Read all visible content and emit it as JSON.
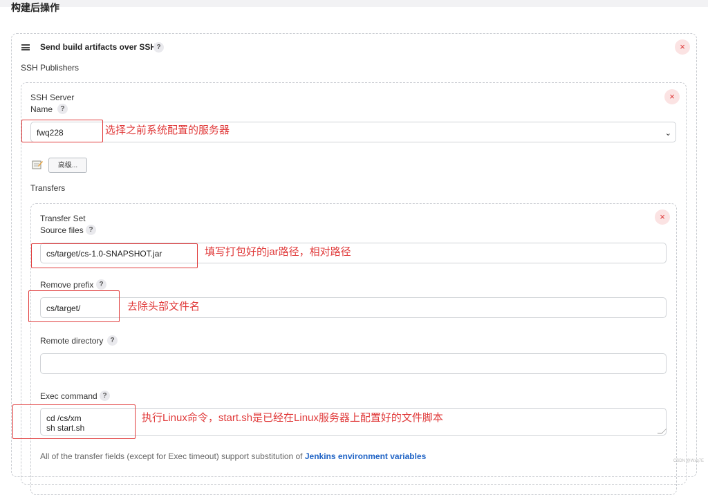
{
  "section": {
    "title": "构建后操作"
  },
  "step": {
    "title": "Send build artifacts over SSH",
    "help": "?",
    "delete": "×",
    "publishers_label": "SSH Publishers"
  },
  "server": {
    "heading": "SSH Server",
    "name_label": "Name",
    "help": "?",
    "delete": "×",
    "name_value": "fwq228",
    "chevron": "⌄",
    "advanced_button": "高级...",
    "transfers_label": "Transfers"
  },
  "transfer": {
    "heading": "Transfer Set",
    "delete": "×",
    "help": "?",
    "source_label": "Source files",
    "source_value": "cs/target/cs-1.0-SNAPSHOT.jar",
    "prefix_label": "Remove prefix",
    "prefix_value": "cs/target/",
    "remote_label": "Remote directory",
    "remote_value": "",
    "exec_label": "Exec command",
    "exec_value": "cd /cs/xm\nsh start.sh",
    "footer_text": "All of the transfer fields (except for Exec timeout) support substitution of ",
    "footer_link": "Jenkins environment variables"
  },
  "annotations": {
    "server": "选择之前系统配置的服务器",
    "source": "填写打包好的jar路径，相对路径",
    "prefix": "去除头部文件名",
    "exec": "执行Linux命令，start.sh是已经在Linux服务器上配置好的文件脚本"
  },
  "watermark": "CSDN @Wxq7E"
}
